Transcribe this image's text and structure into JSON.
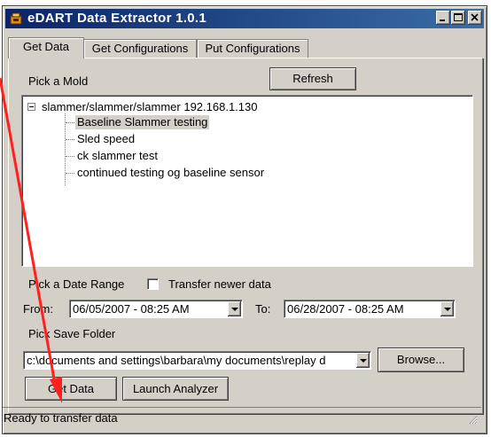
{
  "window": {
    "title": "eDART Data Extractor 1.0.1",
    "controls": [
      "minimize",
      "maximize",
      "close"
    ]
  },
  "tabs": [
    {
      "label": "Get Data",
      "active": true
    },
    {
      "label": "Get Configurations",
      "active": false
    },
    {
      "label": "Put Configurations",
      "active": false
    }
  ],
  "mold_section": {
    "label": "Pick a Mold",
    "refresh_label": "Refresh",
    "tree": {
      "root": "slammer/slammer/slammer 192.168.1.130",
      "children": [
        {
          "label": "Baseline Slammer testing",
          "selected": true
        },
        {
          "label": "Sled speed",
          "selected": false
        },
        {
          "label": "ck slammer test",
          "selected": false
        },
        {
          "label": "continued testing og baseline sensor",
          "selected": false
        }
      ]
    }
  },
  "date_section": {
    "label": "Pick a Date Range",
    "transfer_newer_label": "Transfer newer data",
    "transfer_newer_checked": false,
    "from_label": "From:",
    "from_value": "06/05/2007 - 08:25 AM",
    "to_label": "To:",
    "to_value": "06/28/2007 - 08:25 AM"
  },
  "folder_section": {
    "label": "Pick Save Folder",
    "path_value": "c:\\documents and settings\\barbara\\my documents\\replay d",
    "browse_label": "Browse..."
  },
  "actions": {
    "get_data_label": "Get Data",
    "launch_analyzer_label": "Launch Analyzer"
  },
  "status": {
    "text": "Ready to transfer data"
  },
  "colors": {
    "titlebar_start": "#0a246a",
    "titlebar_end": "#3a6ea5",
    "face": "#d4d0c8",
    "annotation_arrow": "#ff2020"
  },
  "icons": {
    "app": "edart-app-icon",
    "annotation": "red-pointer-arrow"
  }
}
